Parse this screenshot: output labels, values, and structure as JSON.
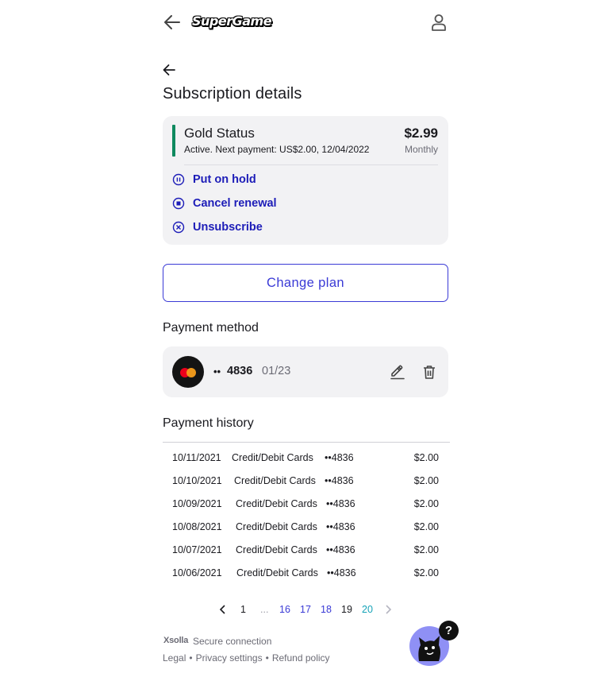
{
  "header": {
    "logo_text": "SuperGame"
  },
  "page": {
    "title": "Subscription details"
  },
  "subscription": {
    "name": "Gold Status",
    "status": "Active. Next payment: US$2.00, 12/04/2022",
    "price": "$2.99",
    "period": "Monthly",
    "accent_color": "#0f8a5f",
    "actions": [
      {
        "label": "Put on hold",
        "icon": "pause-circle-icon"
      },
      {
        "label": "Cancel renewal",
        "icon": "stop-circle-icon"
      },
      {
        "label": "Unsubscribe",
        "icon": "x-circle-icon"
      }
    ]
  },
  "change_plan": {
    "label": "Change plan"
  },
  "payment_method": {
    "heading": "Payment method",
    "dots": "••",
    "last4": "4836",
    "expiry": "01/23",
    "brand_icon": "mastercard-icon"
  },
  "payment_history": {
    "heading": "Payment history",
    "rows": [
      {
        "date": "10/11/2021",
        "method": "Credit/Debit Cards",
        "card": "••4836",
        "amount": "$2.00"
      },
      {
        "date": "10/10/2021",
        "method": "Credit/Debit Cards",
        "card": "••4836",
        "amount": "$2.00"
      },
      {
        "date": "10/09/2021",
        "method": "Credit/Debit Cards",
        "card": "••4836",
        "amount": "$2.00"
      },
      {
        "date": "10/08/2021",
        "method": "Credit/Debit Cards",
        "card": "••4836",
        "amount": "$2.00"
      },
      {
        "date": "10/07/2021",
        "method": "Credit/Debit Cards",
        "card": "••4836",
        "amount": "$2.00"
      },
      {
        "date": "10/06/2021",
        "method": "Credit/Debit Cards",
        "card": "••4836",
        "amount": "$2.00"
      }
    ]
  },
  "pagination": {
    "first": "1",
    "ellipsis": "...",
    "pages": [
      "16",
      "17",
      "18",
      "19",
      "20"
    ],
    "current": "19"
  },
  "footer": {
    "brand": "Xsolla",
    "secure": "Secure connection",
    "links": [
      "Legal",
      "Privacy settings",
      "Refund policy"
    ],
    "separator": "•"
  },
  "help": {
    "badge": "?"
  },
  "colors": {
    "link_blue": "#1d1db8",
    "button_blue": "#3a3ad6",
    "card_bg": "#f2f2f4",
    "help_bg": "#8f90f5"
  }
}
